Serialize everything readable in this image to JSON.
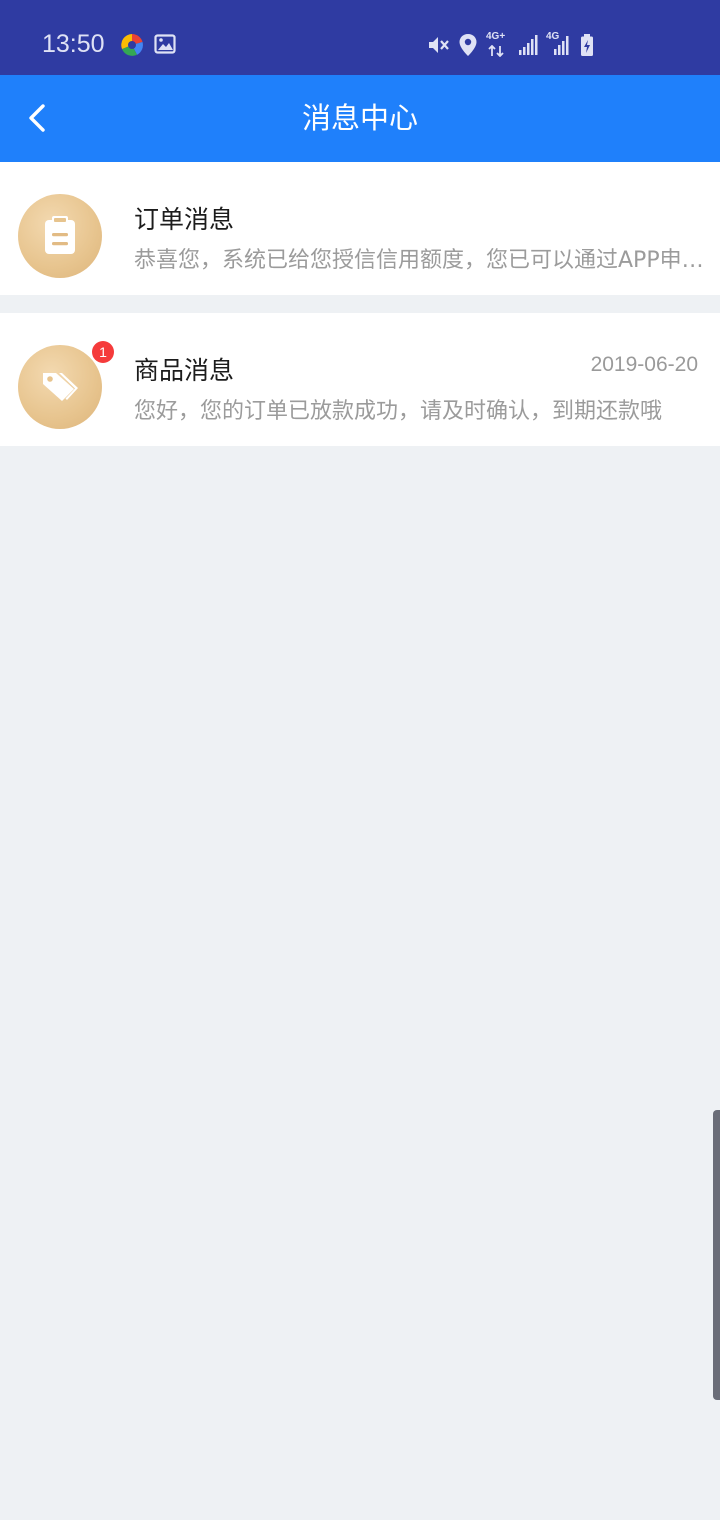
{
  "status_bar": {
    "time": "13:50",
    "left_icons": [
      "multicolor-app-icon",
      "image-icon"
    ],
    "right_icons": [
      "vibrate-mute-icon",
      "location-icon",
      "4g-plus-data-icon",
      "signal-icon",
      "4g-signal-icon",
      "battery-charging-icon"
    ],
    "net1": "4G+",
    "net2": "4G"
  },
  "app_bar": {
    "title": "消息中心",
    "back_icon": "chevron-left-icon"
  },
  "messages": [
    {
      "title": "订单消息",
      "preview": "恭喜您，系统已给您授信信用额度，您已可以通过APP申请借款",
      "date": "",
      "badge": "",
      "icon": "clipboard-icon"
    },
    {
      "title": "商品消息",
      "preview": "您好，您的订单已放款成功，请及时确认，到期还款哦",
      "date": "2019-06-20",
      "badge": "1",
      "icon": "price-tag-icon"
    }
  ],
  "colors": {
    "status_bar": "#2f3ba2",
    "app_bar": "#1f80fb",
    "background": "#eef1f4",
    "avatar": "#e7c48e",
    "badge": "#f53b3b"
  }
}
